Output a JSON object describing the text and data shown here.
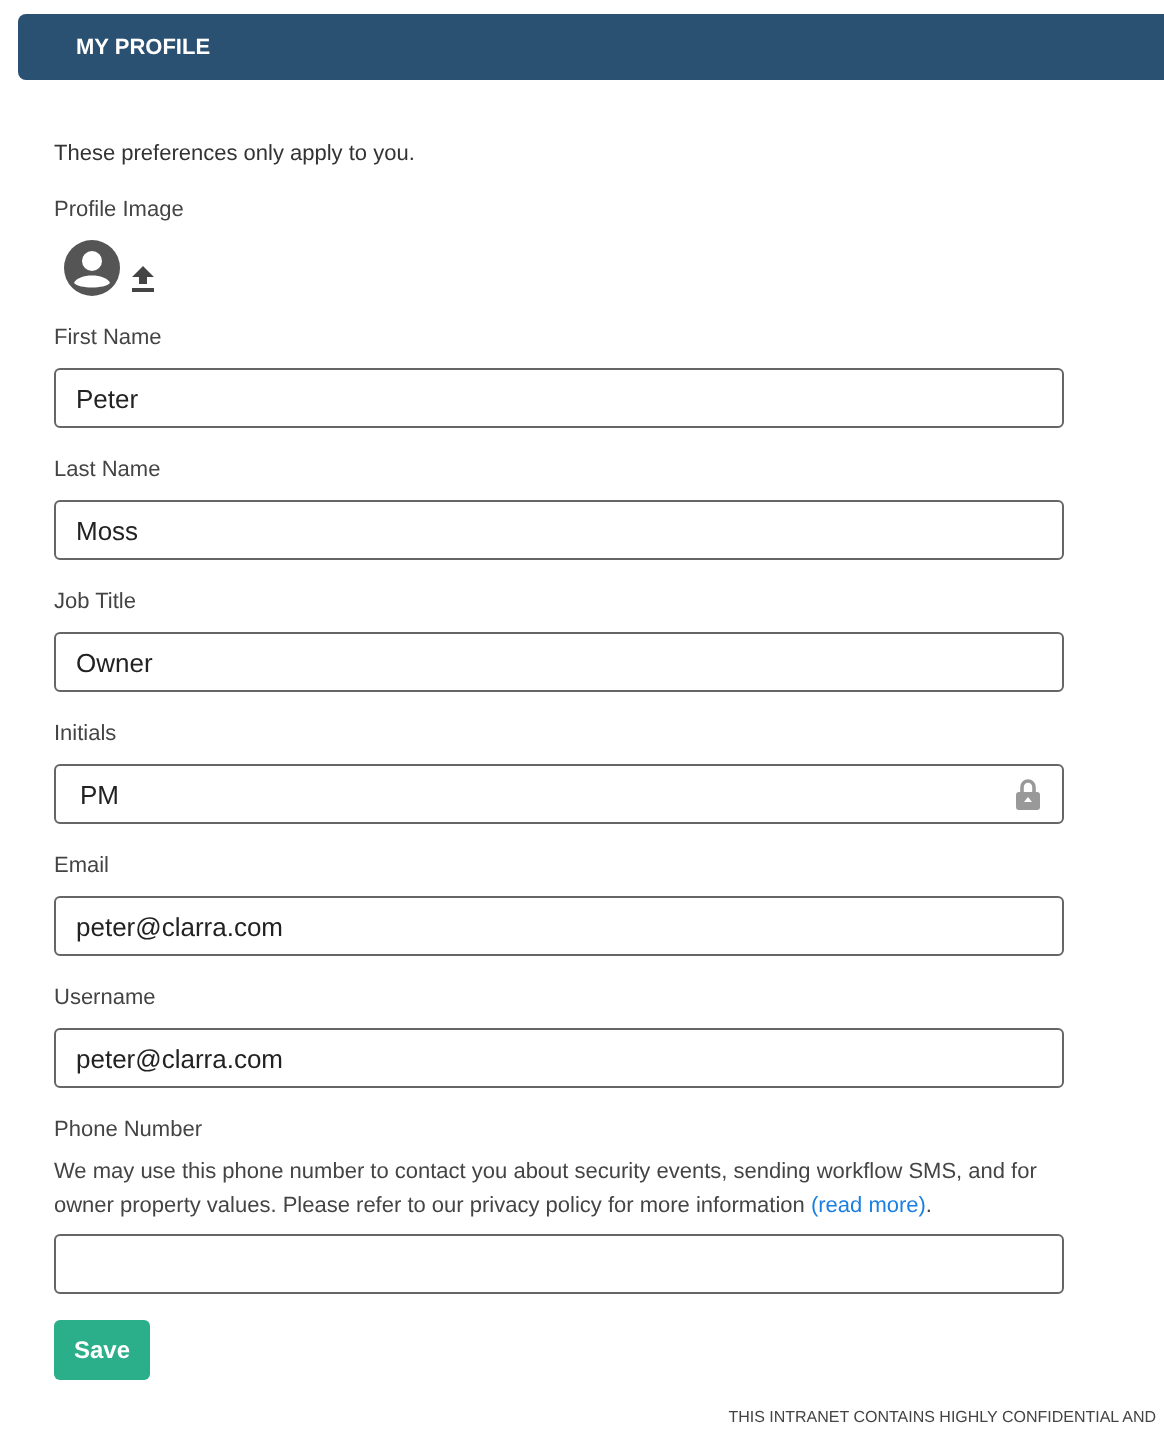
{
  "header": {
    "title": "MY PROFILE"
  },
  "intro": "These preferences only apply to you.",
  "profile_image": {
    "label": "Profile Image"
  },
  "fields": [
    {
      "label": "First Name",
      "value": "Peter",
      "locked": false
    },
    {
      "label": "Last Name",
      "value": "Moss",
      "locked": false
    },
    {
      "label": "Job Title",
      "value": "Owner",
      "locked": false
    },
    {
      "label": "Initials",
      "value": "PM",
      "locked": true
    },
    {
      "label": "Email",
      "value": "peter@clarra.com",
      "locked": false
    },
    {
      "label": "Username",
      "value": "peter@clarra.com",
      "locked": false
    }
  ],
  "phone": {
    "label": "Phone Number",
    "description": "We may use this phone number to contact you about security events, sending workflow SMS, and for owner property values. Please refer to our privacy policy for more information",
    "link": "(read more)",
    "after_link": "."
  },
  "save_button": "Save",
  "footer": "THIS INTRANET CONTAINS HIGHLY CONFIDENTIAL AND"
}
